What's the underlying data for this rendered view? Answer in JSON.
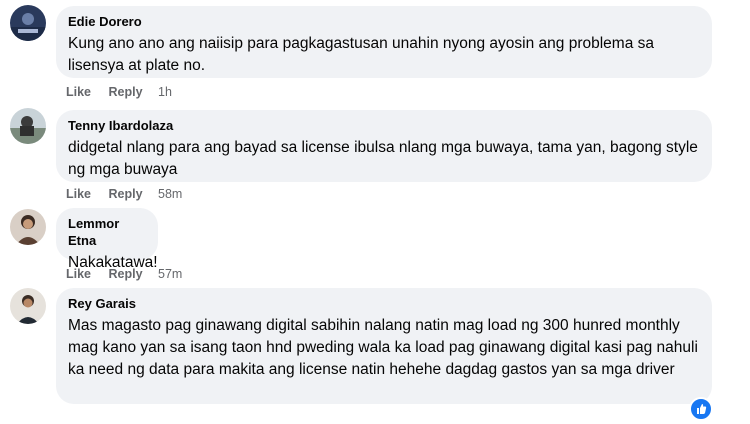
{
  "comments": [
    {
      "author": "Edie Dorero",
      "text": "Kung ano ano ang naiisip para pagkagastusan unahin nyong ayosin ang problema sa lisensya at plate no.",
      "like": "Like",
      "reply": "Reply",
      "time": "1h"
    },
    {
      "author": "Tenny Ibardolaza",
      "text": "didgetal nlang para ang bayad sa license ibulsa nlang mga buwaya, tama yan, bagong style ng mga buwaya",
      "like": "Like",
      "reply": "Reply",
      "time": "58m"
    },
    {
      "author": "Lemmor Etna",
      "text": "Nakakatawa!",
      "like": "Like",
      "reply": "Reply",
      "time": "57m"
    },
    {
      "author": "Rey Garais",
      "text": "Mas magasto pag ginawang digital sabihin nalang natin mag load ng 300 hunred monthly mag kano yan sa isang taon hnd pweding wala ka load pag ginawang digital kasi pag nahuli ka need ng data para makita ang license natin hehehe dagdag gastos yan sa mga driver"
    }
  ],
  "icons": {
    "reaction": "like-reaction-icon"
  },
  "colors": {
    "bubble": "#f0f2f5",
    "meta": "#65676b",
    "accent": "#1877f2"
  }
}
